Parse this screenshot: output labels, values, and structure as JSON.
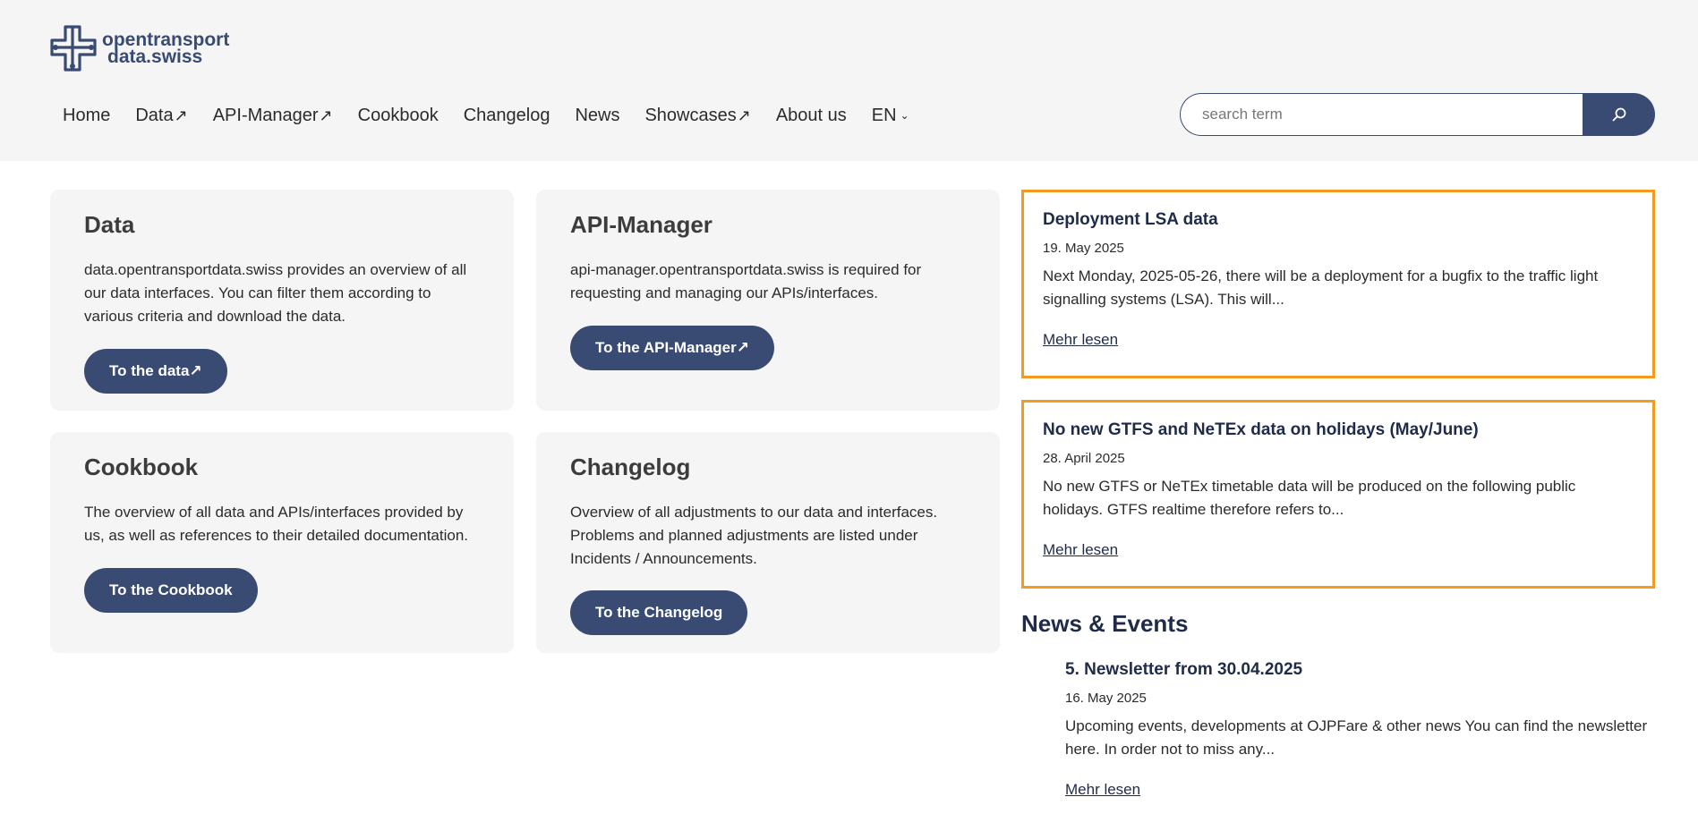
{
  "brand": {
    "line1": "opentransport",
    "line2": "data.swiss"
  },
  "nav": {
    "items": [
      {
        "label": "Home",
        "external": ""
      },
      {
        "label": "Data",
        "external": "↗"
      },
      {
        "label": "API-Manager",
        "external": "↗"
      },
      {
        "label": "Cookbook",
        "external": ""
      },
      {
        "label": "Changelog",
        "external": ""
      },
      {
        "label": "News",
        "external": ""
      },
      {
        "label": "Showcases",
        "external": "↗"
      },
      {
        "label": "About us",
        "external": ""
      }
    ],
    "language": "EN"
  },
  "search": {
    "placeholder": "search term",
    "value": ""
  },
  "cards": {
    "data": {
      "title": "Data",
      "text": "data.opentransportdata.swiss provides an overview of all our data interfaces. You can filter them according to various criteria and download the data.",
      "button": "To the data↗"
    },
    "api": {
      "title": "API-Manager",
      "text": "api-manager.opentransportdata.swiss is required for requesting and managing our APIs/interfaces.",
      "button": "To the API-Manager↗"
    },
    "cookbook": {
      "title": "Cookbook",
      "text": "The overview of all data and APIs/interfaces provided by us, as well as references to their detailed documentation.",
      "button": "To the Cookbook"
    },
    "changelog": {
      "title": "Changelog",
      "text": "Overview of all adjustments to our data and interfaces. Problems and planned adjustments are listed under Incidents / Announcements.",
      "button": "To the Changelog"
    }
  },
  "notices": [
    {
      "title": "Deployment LSA data",
      "date": "19. May 2025",
      "excerpt": "Next Monday, 2025-05-26, there will be a deployment for a bugfix to the traffic light signalling systems (LSA). This will...",
      "link": "Mehr lesen"
    },
    {
      "title": "No new GTFS and NeTEx data on holidays (May/June)",
      "date": "28. April 2025",
      "excerpt": "No new GTFS or NeTEx timetable data will be produced on the following public holidays. GTFS realtime therefore refers to...",
      "link": "Mehr lesen"
    }
  ],
  "news_section": {
    "heading": "News & Events",
    "items": [
      {
        "title": "5. Newsletter from 30.04.2025",
        "date": "16. May 2025",
        "excerpt": "Upcoming events, developments at OJPFare & other news You can find the newsletter here. In order not to miss any...",
        "link": "Mehr lesen"
      }
    ]
  },
  "colors": {
    "brand": "#3a4b73",
    "notice_border": "#f39a1f",
    "card_bg": "#f5f5f5",
    "header_bg": "#f5f5f5"
  },
  "icons": {
    "logo": "swiss-cross-network-logo",
    "search": "search-icon",
    "external": "external-link-arrow",
    "language": "chevron-down-icon"
  }
}
